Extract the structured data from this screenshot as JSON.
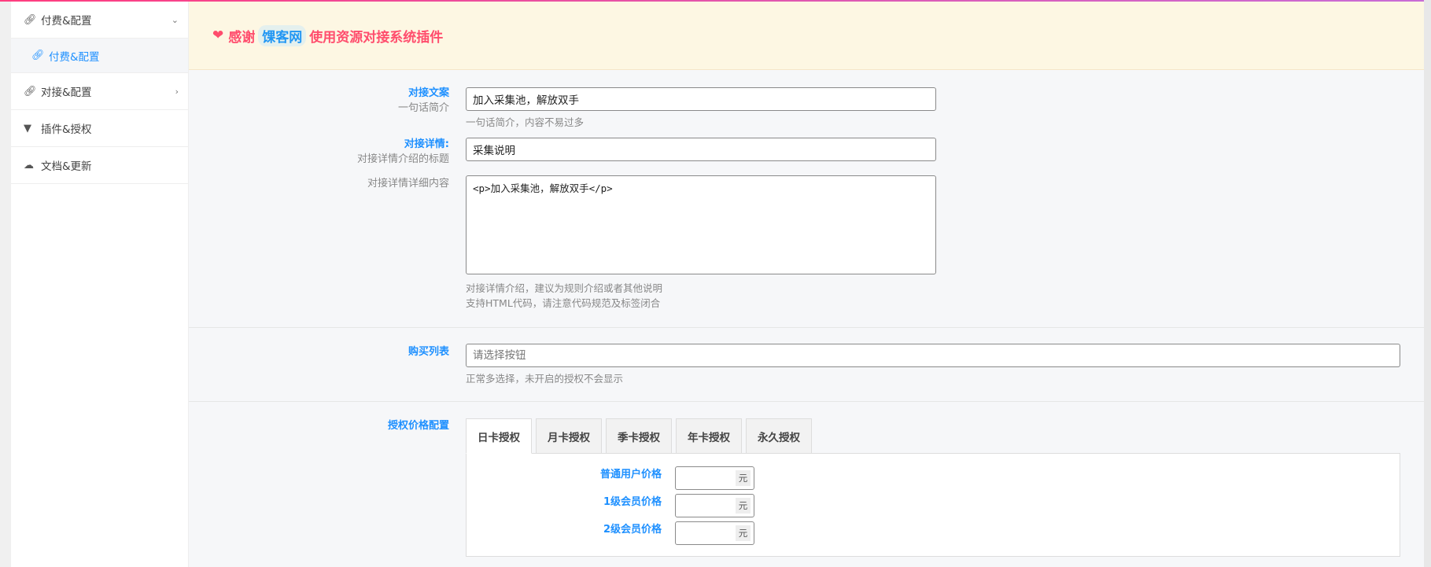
{
  "sidebar": {
    "items": [
      {
        "label": "付费&配置",
        "icon": "link-icon",
        "expanded": true
      },
      {
        "label": "付费&配置",
        "icon": "link-icon",
        "sub": true,
        "active": true
      },
      {
        "label": "对接&配置",
        "icon": "link-icon"
      },
      {
        "label": "插件&授权",
        "icon": "gitlab-icon"
      },
      {
        "label": "文档&更新",
        "icon": "cloud-upload-icon"
      }
    ]
  },
  "banner": {
    "prefix": "感谢",
    "brand": "馃客网",
    "suffix": "使用资源对接系统插件"
  },
  "form": {
    "copy": {
      "title": "对接文案",
      "subtitle": "一句话简介",
      "value": "加入采集池，解放双手",
      "help": "一句话简介，内容不易过多"
    },
    "detail_title": {
      "title": "对接详情:",
      "subtitle": "对接详情介绍的标题",
      "value": "采集说明"
    },
    "detail_content": {
      "subtitle": "对接详情详细内容",
      "value": "<p>加入采集池，解放双手</p>",
      "help1": "对接详情介绍，建议为规则介绍或者其他说明",
      "help2": "支持HTML代码，请注意代码规范及标签闭合"
    },
    "buy_list": {
      "title": "购买列表",
      "placeholder": "请选择按钮",
      "help": "正常多选择，未开启的授权不会显示"
    },
    "price": {
      "title": "授权价格配置",
      "tabs": [
        "日卡授权",
        "月卡授权",
        "季卡授权",
        "年卡授权",
        "永久授权"
      ],
      "rows": [
        {
          "label": "普通用户价格",
          "value": "",
          "unit": "元"
        },
        {
          "label": "1级会员价格",
          "value": "",
          "unit": "元"
        },
        {
          "label": "2级会员价格",
          "value": "",
          "unit": "元"
        }
      ]
    }
  },
  "colors": {
    "accent": "#1e90ff",
    "banner_text": "#ff4d6d",
    "banner_bg": "#fdf7e3"
  }
}
